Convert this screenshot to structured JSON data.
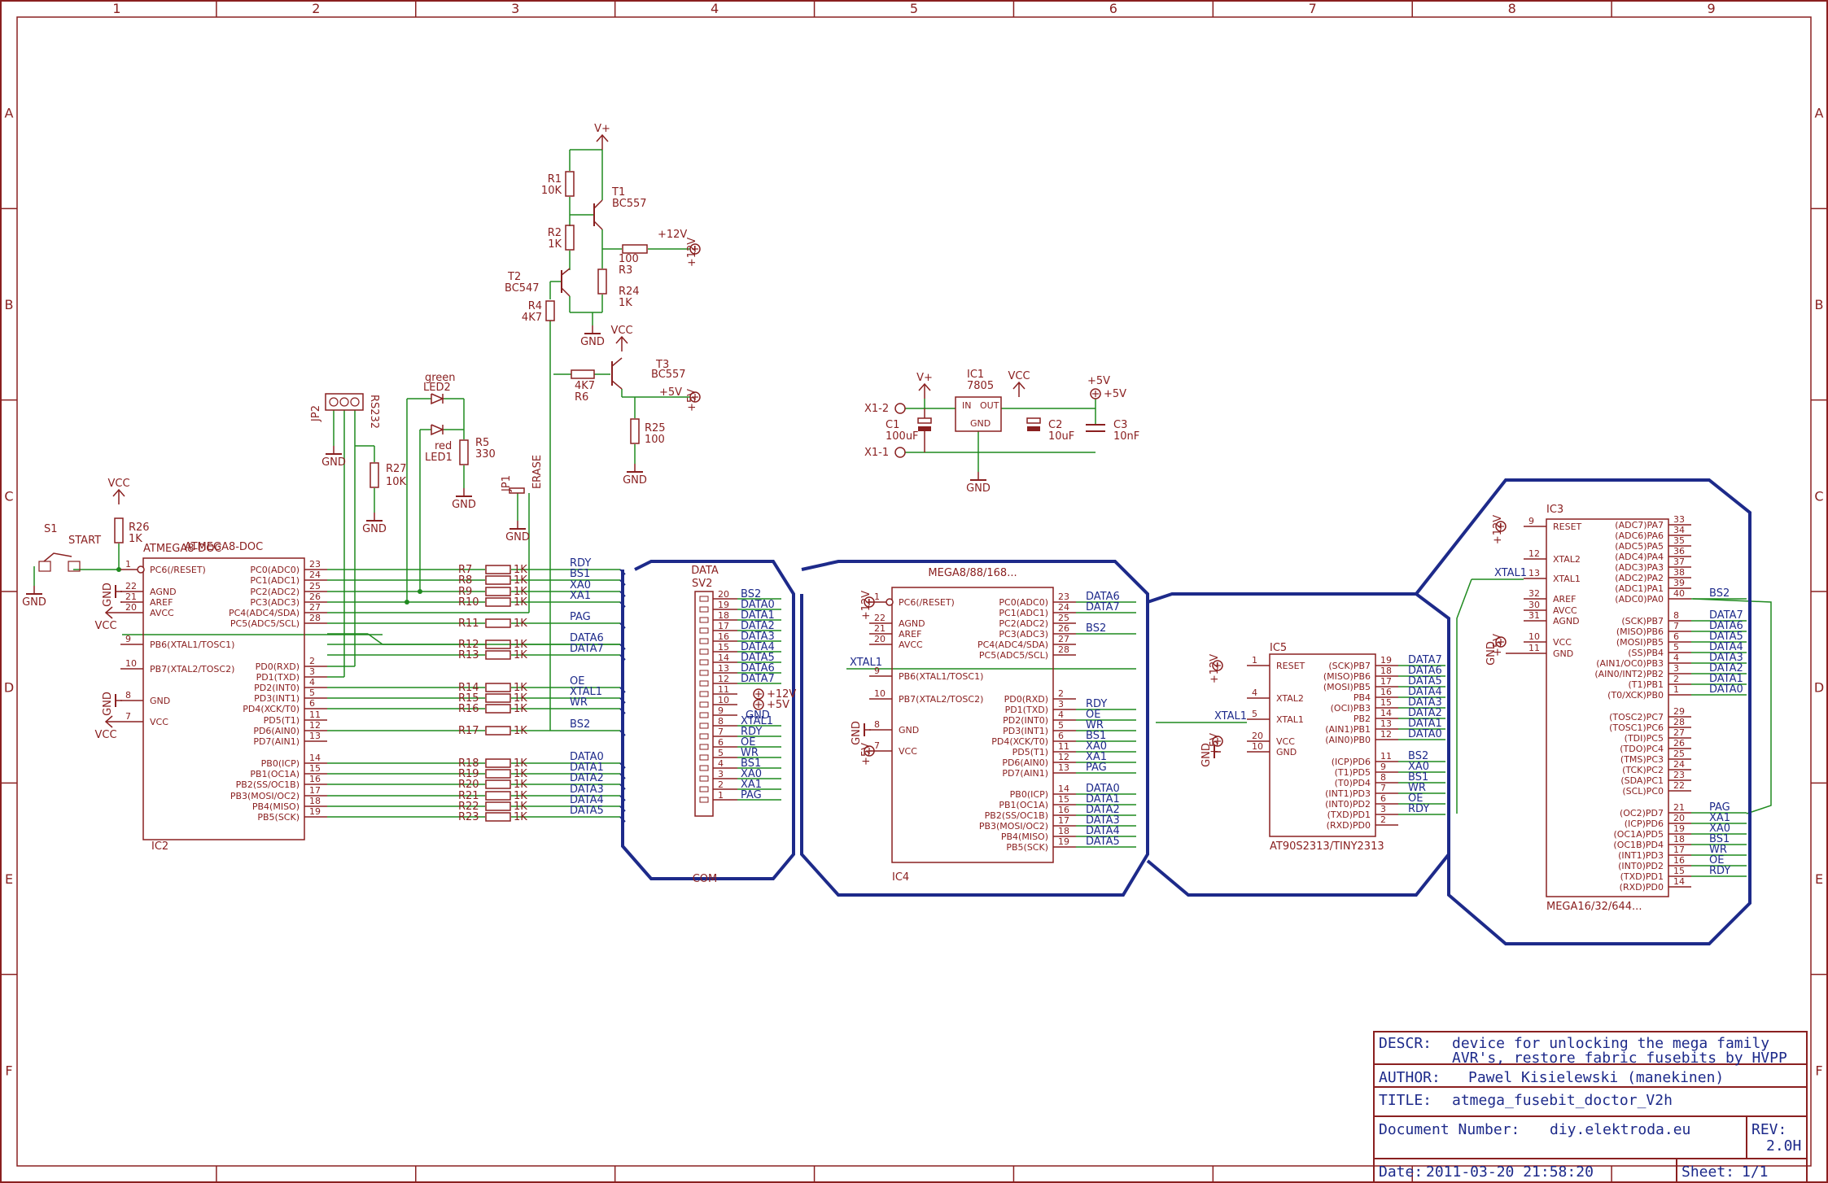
{
  "grid": {
    "columns": [
      "1",
      "2",
      "3",
      "4",
      "5",
      "6",
      "7",
      "8",
      "9"
    ],
    "rows": [
      "A",
      "B",
      "C",
      "D",
      "E",
      "F"
    ]
  },
  "title_block": {
    "descr_label": "DESCR:",
    "descr_line1": "device for unlocking the mega family",
    "descr_line2": "AVR's, restore fabric fusebits by HVPP",
    "author_label": "AUTHOR:",
    "author": "Pawel Kisielewski (manekinen)",
    "title_label": "TITLE:",
    "title": "atmega_fusebit_doctor_V2h",
    "docnum_label": "Document Number:",
    "docnum": "diy.elektroda.eu",
    "rev_label": "REV:",
    "rev": "2.0H",
    "date_label": "Date:",
    "date": "2011-03-20 21:58:20",
    "sheet_label": "Sheet:",
    "sheet": "1/1"
  },
  "parts": {
    "ic2": {
      "name": "IC2",
      "value": "ATMEGA8-DOC"
    },
    "ic4": {
      "name": "IC4",
      "value": "MEGA8/88/168..."
    },
    "ic5": {
      "name": "IC5",
      "value": "AT90S2313/TINY2313"
    },
    "ic3": {
      "name": "IC3",
      "value": "MEGA16/32/644..."
    },
    "ic1": {
      "name": "IC1",
      "value": "7805"
    },
    "sv2": {
      "name": "SV2",
      "top": "DATA",
      "bottom": "COM"
    },
    "t1": {
      "name": "T1",
      "value": "BC557"
    },
    "t2": {
      "name": "T2",
      "value": "BC547"
    },
    "t3": {
      "name": "T3",
      "value": "BC557"
    },
    "r1": {
      "name": "R1",
      "value": "10K"
    },
    "r2": {
      "name": "R2",
      "value": "1K"
    },
    "r3": {
      "name": "R3",
      "value": "100"
    },
    "r24": {
      "name": "R24",
      "value": "1K"
    },
    "r4": {
      "name": "R4",
      "value": "4K7"
    },
    "r6": {
      "name": "R6",
      "value": "4K7"
    },
    "r25": {
      "name": "R25",
      "value": "100"
    },
    "r5": {
      "name": "R5",
      "value": "330"
    },
    "r26": {
      "name": "R26",
      "value": "1K"
    },
    "r27": {
      "name": "R27",
      "value": "10K"
    },
    "led2": {
      "name": "LED2",
      "color": "green"
    },
    "led1": {
      "name": "LED1",
      "color": "red"
    },
    "jp2": {
      "name": "JP2",
      "label": "RS232"
    },
    "jp1": {
      "name": "JP1",
      "label": "ERASE"
    },
    "s1": {
      "name": "S1",
      "label": "START"
    },
    "c1": {
      "name": "C1",
      "value": "100uF"
    },
    "c2": {
      "name": "C2",
      "value": "10uF"
    },
    "c3": {
      "name": "C3",
      "value": "10nF"
    },
    "x1_2": "X1-2",
    "x1_1": "X1-1"
  },
  "supplies": {
    "gnd": "GND",
    "vcc": "VCC",
    "vplus": "V+",
    "p12": "+12V",
    "p5": "+5V"
  },
  "ic2_left_pins": [
    {
      "n": "1",
      "name": "PC6(/RESET)"
    },
    {
      "n": "22",
      "name": "AGND"
    },
    {
      "n": "21",
      "name": "AREF"
    },
    {
      "n": "20",
      "name": "AVCC"
    },
    {
      "n": "9",
      "name": "PB6(XTAL1/TOSC1)"
    },
    {
      "n": "10",
      "name": "PB7(XTAL2/TOSC2)"
    },
    {
      "n": "8",
      "name": "GND"
    },
    {
      "n": "7",
      "name": "VCC"
    }
  ],
  "ic2_right_pins": [
    {
      "n": "23",
      "name": "PC0(ADC0)"
    },
    {
      "n": "24",
      "name": "PC1(ADC1)"
    },
    {
      "n": "25",
      "name": "PC2(ADC2)"
    },
    {
      "n": "26",
      "name": "PC3(ADC3)"
    },
    {
      "n": "27",
      "name": "PC4(ADC4/SDA)"
    },
    {
      "n": "28",
      "name": "PC5(ADC5/SCL)"
    },
    {
      "n": "2",
      "name": "PD0(RXD)"
    },
    {
      "n": "3",
      "name": "PD1(TXD)"
    },
    {
      "n": "4",
      "name": "PD2(INT0)"
    },
    {
      "n": "5",
      "name": "PD3(INT1)"
    },
    {
      "n": "6",
      "name": "PD4(XCK/T0)"
    },
    {
      "n": "11",
      "name": "PD5(T1)"
    },
    {
      "n": "12",
      "name": "PD6(AIN0)"
    },
    {
      "n": "13",
      "name": "PD7(AIN1)"
    },
    {
      "n": "14",
      "name": "PB0(ICP)"
    },
    {
      "n": "15",
      "name": "PB1(OC1A)"
    },
    {
      "n": "16",
      "name": "PB2(SS/OC1B)"
    },
    {
      "n": "17",
      "name": "PB3(MOSI/OC2)"
    },
    {
      "n": "18",
      "name": "PB4(MISO)"
    },
    {
      "n": "19",
      "name": "PB5(SCK)"
    }
  ],
  "ic2_resistors": [
    {
      "r": "R7",
      "v": "1K",
      "net": "RDY"
    },
    {
      "r": "R8",
      "v": "1K",
      "net": "BS1"
    },
    {
      "r": "R9",
      "v": "1K",
      "net": "XA0"
    },
    {
      "r": "R10",
      "v": "1K",
      "net": "XA1"
    },
    {
      "r": "R11",
      "v": "1K",
      "net": "PAG"
    },
    {
      "r": "R12",
      "v": "1K",
      "net": "DATA6"
    },
    {
      "r": "R13",
      "v": "1K",
      "net": "DATA7"
    },
    {
      "r": "R14",
      "v": "1K",
      "net": "OE"
    },
    {
      "r": "R15",
      "v": "1K",
      "net": "XTAL1"
    },
    {
      "r": "R16",
      "v": "1K",
      "net": "WR"
    },
    {
      "r": "R17",
      "v": "1K",
      "net": "BS2"
    },
    {
      "r": "R18",
      "v": "1K",
      "net": "DATA0"
    },
    {
      "r": "R19",
      "v": "1K",
      "net": "DATA1"
    },
    {
      "r": "R20",
      "v": "1K",
      "net": "DATA2"
    },
    {
      "r": "R21",
      "v": "1K",
      "net": "DATA3"
    },
    {
      "r": "R22",
      "v": "1K",
      "net": "DATA4"
    },
    {
      "r": "R23",
      "v": "1K",
      "net": "DATA5"
    }
  ],
  "sv2_pins": [
    {
      "n": "20",
      "net": "BS2"
    },
    {
      "n": "19",
      "net": "DATA0"
    },
    {
      "n": "18",
      "net": "DATA1"
    },
    {
      "n": "17",
      "net": "DATA2"
    },
    {
      "n": "16",
      "net": "DATA3"
    },
    {
      "n": "15",
      "net": "DATA4"
    },
    {
      "n": "14",
      "net": "DATA5"
    },
    {
      "n": "13",
      "net": "DATA6"
    },
    {
      "n": "12",
      "net": "DATA7"
    },
    {
      "n": "11",
      "net": "+12V"
    },
    {
      "n": "10",
      "net": "+5V"
    },
    {
      "n": "9",
      "net": "GND"
    },
    {
      "n": "8",
      "net": "XTAL1"
    },
    {
      "n": "7",
      "net": "RDY"
    },
    {
      "n": "6",
      "net": "OE"
    },
    {
      "n": "5",
      "net": "WR"
    },
    {
      "n": "4",
      "net": "BS1"
    },
    {
      "n": "3",
      "net": "XA0"
    },
    {
      "n": "2",
      "net": "XA1"
    },
    {
      "n": "1",
      "net": "PAG"
    }
  ],
  "ic4_left_pins": [
    {
      "n": "1",
      "name": "PC6(/RESET)"
    },
    {
      "n": "22",
      "name": "AGND"
    },
    {
      "n": "21",
      "name": "AREF"
    },
    {
      "n": "20",
      "name": "AVCC"
    },
    {
      "n": "9",
      "name": "PB6(XTAL1/TOSC1)"
    },
    {
      "n": "10",
      "name": "PB7(XTAL2/TOSC2)"
    },
    {
      "n": "8",
      "name": "GND"
    },
    {
      "n": "7",
      "name": "VCC"
    }
  ],
  "ic4_right_pins": [
    {
      "n": "23",
      "name": "PC0(ADC0)",
      "net": "DATA6"
    },
    {
      "n": "24",
      "name": "PC1(ADC1)",
      "net": "DATA7"
    },
    {
      "n": "25",
      "name": "PC2(ADC2)",
      "net": ""
    },
    {
      "n": "26",
      "name": "PC3(ADC3)",
      "net": "BS2"
    },
    {
      "n": "27",
      "name": "PC4(ADC4/SDA)",
      "net": ""
    },
    {
      "n": "28",
      "name": "PC5(ADC5/SCL)",
      "net": ""
    },
    {
      "n": "2",
      "name": "PD0(RXD)",
      "net": ""
    },
    {
      "n": "3",
      "name": "PD1(TXD)",
      "net": "RDY"
    },
    {
      "n": "4",
      "name": "PD2(INT0)",
      "net": "OE"
    },
    {
      "n": "5",
      "name": "PD3(INT1)",
      "net": "WR"
    },
    {
      "n": "6",
      "name": "PD4(XCK/T0)",
      "net": "BS1"
    },
    {
      "n": "11",
      "name": "PD5(T1)",
      "net": "XA0"
    },
    {
      "n": "12",
      "name": "PD6(AIN0)",
      "net": "XA1"
    },
    {
      "n": "13",
      "name": "PD7(AIN1)",
      "net": "PAG"
    },
    {
      "n": "14",
      "name": "PB0(ICP)",
      "net": "DATA0"
    },
    {
      "n": "15",
      "name": "PB1(OC1A)",
      "net": "DATA1"
    },
    {
      "n": "16",
      "name": "PB2(SS/OC1B)",
      "net": "DATA2"
    },
    {
      "n": "17",
      "name": "PB3(MOSI/OC2)",
      "net": "DATA3"
    },
    {
      "n": "18",
      "name": "PB4(MISO)",
      "net": "DATA4"
    },
    {
      "n": "19",
      "name": "PB5(SCK)",
      "net": "DATA5"
    }
  ],
  "ic5_left_pins": [
    {
      "n": "1",
      "name": "RESET"
    },
    {
      "n": "4",
      "name": "XTAL2"
    },
    {
      "n": "5",
      "name": "XTAL1"
    },
    {
      "n": "20",
      "name": "VCC"
    },
    {
      "n": "10",
      "name": "GND"
    }
  ],
  "ic5_right_pins": [
    {
      "n": "19",
      "name": "(SCK)PB7",
      "net": "DATA7"
    },
    {
      "n": "18",
      "name": "(MISO)PB6",
      "net": "DATA6"
    },
    {
      "n": "17",
      "name": "(MOSI)PB5",
      "net": "DATA5"
    },
    {
      "n": "16",
      "name": "PB4",
      "net": "DATA4"
    },
    {
      "n": "15",
      "name": "(OCI)PB3",
      "net": "DATA3"
    },
    {
      "n": "14",
      "name": "PB2",
      "net": "DATA2"
    },
    {
      "n": "13",
      "name": "(AIN1)PB1",
      "net": "DATA1"
    },
    {
      "n": "12",
      "name": "(AIN0)PB0",
      "net": "DATA0"
    },
    {
      "n": "11",
      "name": "(ICP)PD6",
      "net": "BS2"
    },
    {
      "n": "9",
      "name": "(T1)PD5",
      "net": "XA0"
    },
    {
      "n": "8",
      "name": "(T0)PD4",
      "net": "BS1"
    },
    {
      "n": "7",
      "name": "(INT1)PD3",
      "net": "WR"
    },
    {
      "n": "6",
      "name": "(INT0)PD2",
      "net": "OE"
    },
    {
      "n": "3",
      "name": "(TXD)PD1",
      "net": "RDY"
    },
    {
      "n": "2",
      "name": "(RXD)PD0",
      "net": ""
    }
  ],
  "ic3_left_pins": [
    {
      "n": "9",
      "name": "RESET"
    },
    {
      "n": "12",
      "name": "XTAL2"
    },
    {
      "n": "13",
      "name": "XTAL1"
    },
    {
      "n": "32",
      "name": "AREF"
    },
    {
      "n": "30",
      "name": "AVCC"
    },
    {
      "n": "31",
      "name": "AGND"
    },
    {
      "n": "10",
      "name": "VCC"
    },
    {
      "n": "11",
      "name": "GND"
    }
  ],
  "ic3_right_pins": [
    {
      "n": "33",
      "name": "(ADC7)PA7",
      "net": ""
    },
    {
      "n": "34",
      "name": "(ADC6)PA6",
      "net": ""
    },
    {
      "n": "35",
      "name": "(ADC5)PA5",
      "net": ""
    },
    {
      "n": "36",
      "name": "(ADC4)PA4",
      "net": ""
    },
    {
      "n": "37",
      "name": "(ADC3)PA3",
      "net": ""
    },
    {
      "n": "38",
      "name": "(ADC2)PA2",
      "net": ""
    },
    {
      "n": "39",
      "name": "(ADC1)PA1",
      "net": ""
    },
    {
      "n": "40",
      "name": "(ADC0)PA0",
      "net": "BS2"
    },
    {
      "n": "8",
      "name": "(SCK)PB7",
      "net": "DATA7"
    },
    {
      "n": "7",
      "name": "(MISO)PB6",
      "net": "DATA6"
    },
    {
      "n": "6",
      "name": "(MOSI)PB5",
      "net": "DATA5"
    },
    {
      "n": "5",
      "name": "(SS)PB4",
      "net": "DATA4"
    },
    {
      "n": "4",
      "name": "(AIN1/OC0)PB3",
      "net": "DATA3"
    },
    {
      "n": "3",
      "name": "(AIN0/INT2)PB2",
      "net": "DATA2"
    },
    {
      "n": "2",
      "name": "(T1)PB1",
      "net": "DATA1"
    },
    {
      "n": "1",
      "name": "(T0/XCK)PB0",
      "net": "DATA0"
    },
    {
      "n": "29",
      "name": "(TOSC2)PC7",
      "net": ""
    },
    {
      "n": "28",
      "name": "(TOSC1)PC6",
      "net": ""
    },
    {
      "n": "27",
      "name": "(TDI)PC5",
      "net": ""
    },
    {
      "n": "26",
      "name": "(TDO)PC4",
      "net": ""
    },
    {
      "n": "25",
      "name": "(TMS)PC3",
      "net": ""
    },
    {
      "n": "24",
      "name": "(TCK)PC2",
      "net": ""
    },
    {
      "n": "23",
      "name": "(SDA)PC1",
      "net": ""
    },
    {
      "n": "22",
      "name": "(SCL)PC0",
      "net": ""
    },
    {
      "n": "21",
      "name": "(OC2)PD7",
      "net": "PAG"
    },
    {
      "n": "20",
      "name": "(ICP)PD6",
      "net": "XA1"
    },
    {
      "n": "19",
      "name": "(OC1A)PD5",
      "net": "XA0"
    },
    {
      "n": "18",
      "name": "(OC1B)PD4",
      "net": "BS1"
    },
    {
      "n": "17",
      "name": "(INT1)PD3",
      "net": "WR"
    },
    {
      "n": "16",
      "name": "(INT0)PD2",
      "net": "OE"
    },
    {
      "n": "15",
      "name": "(TXD)PD1",
      "net": "RDY"
    },
    {
      "n": "14",
      "name": "(RXD)PD0",
      "net": ""
    }
  ],
  "colors": {
    "frame": "#8a2020",
    "wire": "#1f8a1f",
    "bus": "#1d2a8a",
    "text": "#8a2020"
  }
}
